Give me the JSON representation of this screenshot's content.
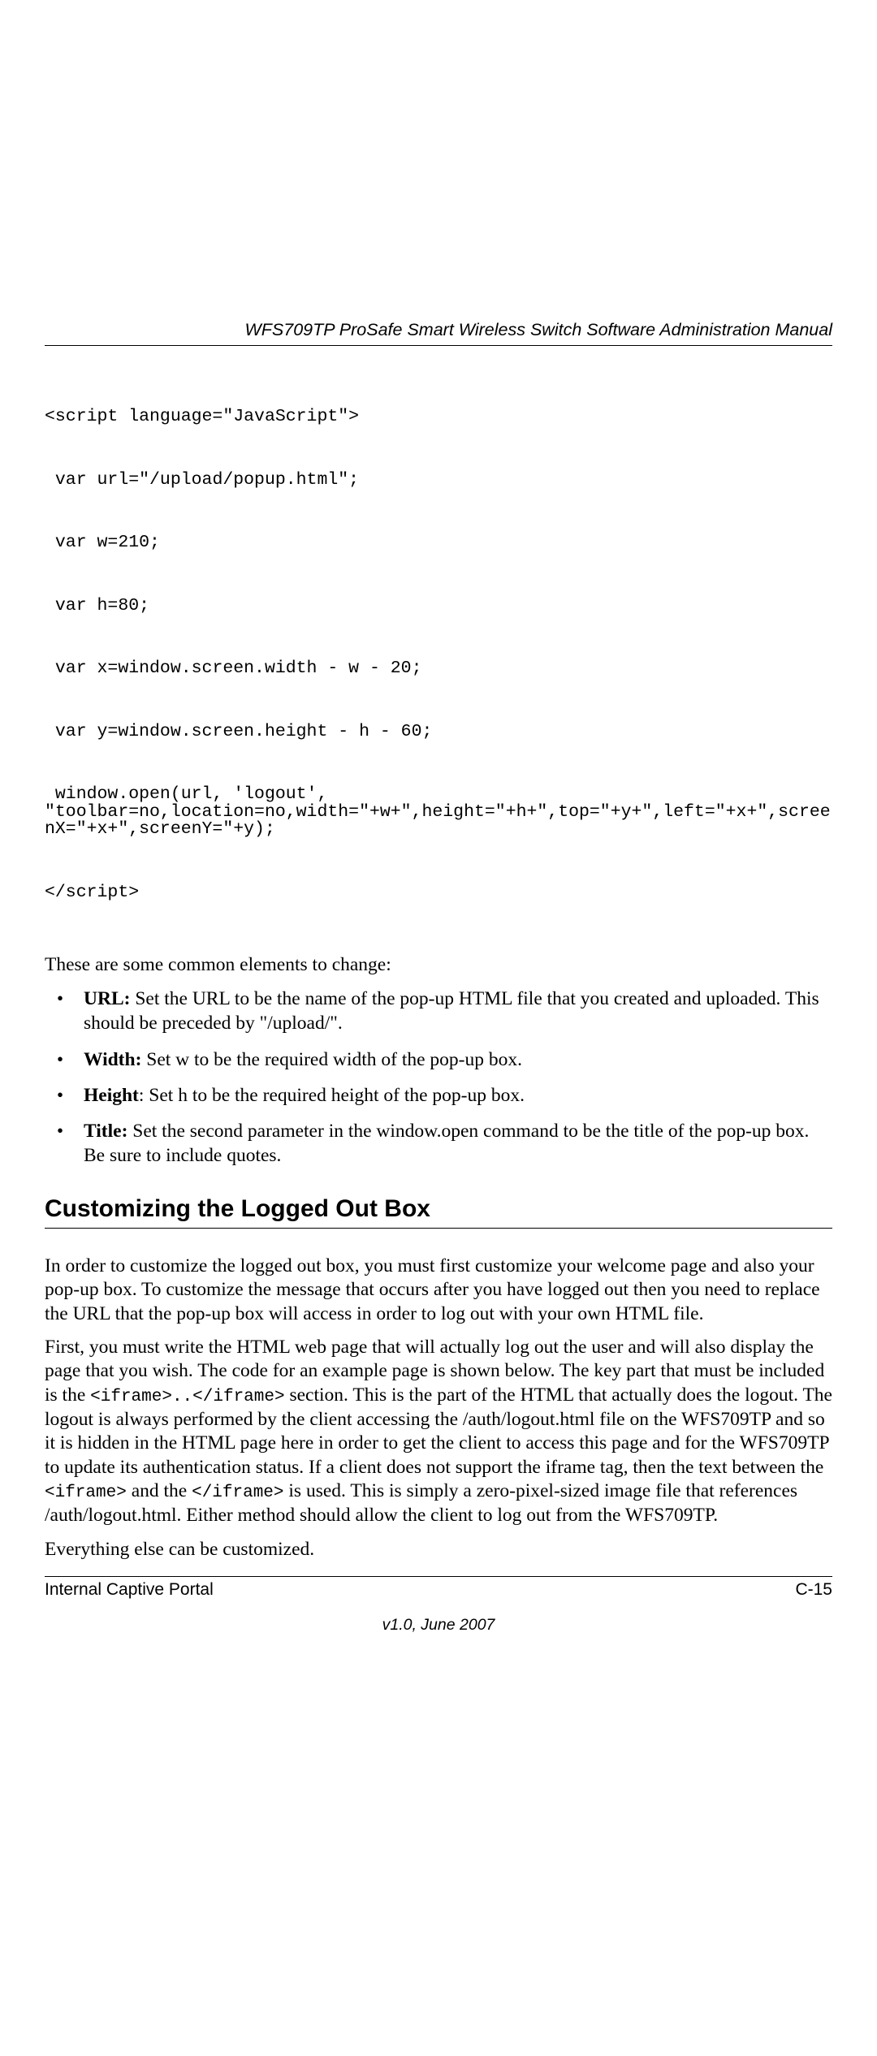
{
  "header": {
    "title": "WFS709TP ProSafe Smart Wireless Switch Software Administration Manual"
  },
  "code": {
    "l1": "<script language=\"JavaScript\">",
    "l2": " var url=\"/upload/popup.html\";",
    "l3": " var w=210;",
    "l4": " var h=80;",
    "l5": " var x=window.screen.width - w - 20;",
    "l6": " var y=window.screen.height - h - 60;",
    "l7": " window.open(url, 'logout', \"toolbar=no,location=no,width=\"+w+\",height=\"+h+\",top=\"+y+\",left=\"+x+\",screenX=\"+x+\",screenY=\"+y);",
    "l8": "</script>"
  },
  "intro": "These are some common elements to change:",
  "bullets": {
    "b1_label": "URL:",
    "b1_text": " Set the URL to be the name of the pop-up HTML file that you created and uploaded. This should be preceded by \"/upload/\".",
    "b2_label": "Width:",
    "b2_text": " Set w to be the required width of the pop-up box.",
    "b3_label": "Height",
    "b3_text": ": Set h to be the required height of the pop-up box.",
    "b4_label": "Title:",
    "b4_text": " Set the second parameter in the window.open command to be the title of the pop-up box. Be sure to include quotes."
  },
  "section": {
    "heading": "Customizing the Logged Out Box",
    "p1": "In order to customize the logged out box, you must first customize your welcome page and also your pop-up box. To customize the message that occurs after you have logged out then you need to replace the URL that the pop-up box will access in order to log out with your own HTML file.",
    "p2a": "First, you must write the HTML web page that will actually log out the user and will also display the page that you wish. The code for an example page is shown below. The key part that must be included is the ",
    "p2_code1": "<iframe>..</iframe>",
    "p2b": " section. This is the part of the HTML that actually does the logout. The logout is always performed by the client accessing the /auth/logout.html file on the WFS709TP and so it is hidden in the HTML page here in order to get the client to access this page and for the WFS709TP to update its authentication status. If a client does not support the iframe tag, then the text between the ",
    "p2_code2": "<iframe>",
    "p2c": " and the ",
    "p2_code3": "</iframe>",
    "p2d": " is used. This is simply a zero-pixel-sized image file that references /auth/logout.html. Either method should allow the client to log out from the WFS709TP.",
    "p3": "Everything else can be customized."
  },
  "footer": {
    "left": "Internal Captive Portal",
    "right": "C-15",
    "version": "v1.0, June 2007"
  }
}
